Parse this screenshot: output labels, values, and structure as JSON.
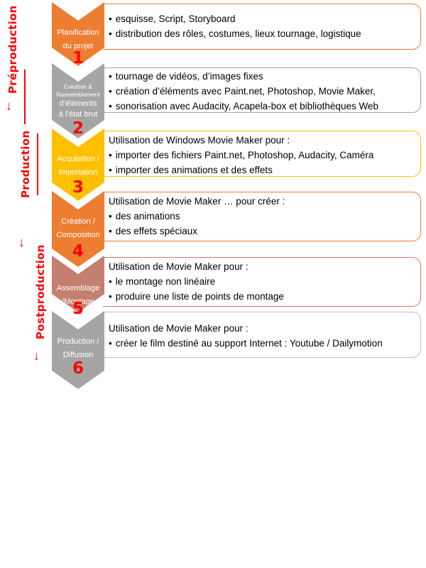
{
  "phases": [
    {
      "label": "Préproduction",
      "color": "#ff0000"
    },
    {
      "label": "Production",
      "color": "#ff0000"
    },
    {
      "label": "Postproduction",
      "color": "#ff0000"
    }
  ],
  "steps": [
    {
      "number": "1",
      "title_lines": [
        "Planification",
        "du projet"
      ],
      "color": "#ed7d31",
      "border": "#ed7d31",
      "intro": "",
      "bullets": [
        "esquisse, Script, Storyboard",
        "distribution des rôles, costumes, lieux tournage, logistique"
      ]
    },
    {
      "number": "2",
      "title_lines": [
        "Création  &",
        "Rassemblement",
        "d’éléments",
        "à l’état brut"
      ],
      "color": "#a5a5a5",
      "border": "#a5a5a5",
      "intro": "",
      "bullets": [
        "tournage de vidéos, d’images fixes",
        "création d’éléments avec Paint.net, Photoshop,  Movie Maker,",
        "sonorisation avec Audacity, Acapela-box et bibliothèques Web"
      ]
    },
    {
      "number": "3",
      "title_lines": [
        "Acquisition /",
        "Importation"
      ],
      "color": "#ffc000",
      "border": "#ffc000",
      "intro": "Utilisation de Windows Movie Maker pour :",
      "bullets": [
        "importer  des fichiers Paint.net, Photoshop, Audacity, Caméra",
        "importer  des animations et des effets"
      ]
    },
    {
      "number": "4",
      "title_lines": [
        "Création /",
        "Composition"
      ],
      "color": "#ed7d31",
      "border": "#ed7d31",
      "intro": "Utilisation de Movie Maker … pour  créer :",
      "bullets": [
        "des animations",
        "des effets spéciaux"
      ]
    },
    {
      "number": "5",
      "title_lines": [
        "Assemblage",
        "/Montage"
      ],
      "color": "#c47f6f",
      "border": "#c47f6f",
      "intro": "Utilisation de Movie Maker pour :",
      "bullets": [
        "le montage non linéaire",
        "produire  une liste de points de montage"
      ]
    },
    {
      "number": "6",
      "title_lines": [
        "Production /",
        "Diffusion"
      ],
      "color": "#a5a5a5",
      "border": "#bfbfbf",
      "intro": "Utilisation de Movie Maker pour :",
      "bullets": [
        "créer le film destiné au support Internet : Youtube / Dailymotion"
      ]
    }
  ]
}
